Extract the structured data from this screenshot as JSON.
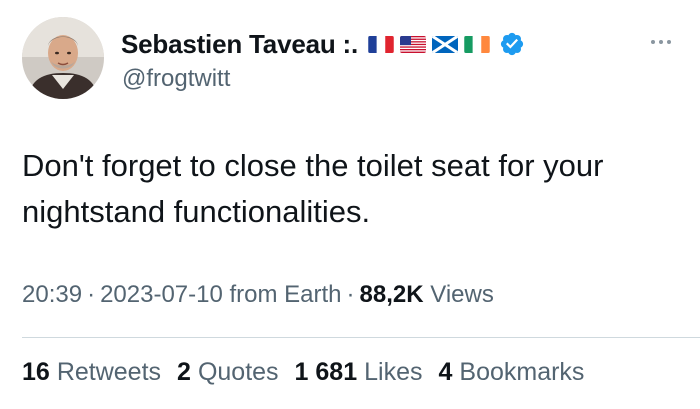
{
  "author": {
    "display_name": "Sebastien Taveau :.",
    "handle": "@frogtwitt",
    "flags": [
      "france-flag-icon",
      "usa-flag-icon",
      "scotland-flag-icon",
      "ireland-flag-icon"
    ],
    "verified": true
  },
  "tweet": {
    "text": "Don't forget to close the toilet seat for your nightstand functionalities.",
    "time": "20:39",
    "date": "2023-07-10",
    "source": "from Earth",
    "views_count": "88,2K",
    "views_label": "Views"
  },
  "stats": {
    "retweets_count": "16",
    "retweets_label": "Retweets",
    "quotes_count": "2",
    "quotes_label": "Quotes",
    "likes_count": "1 681",
    "likes_label": "Likes",
    "bookmarks_count": "4",
    "bookmarks_label": "Bookmarks"
  },
  "colors": {
    "text_primary": "#0f1419",
    "text_secondary": "#536471",
    "verified_blue": "#1d9bf0",
    "divider": "#cfd9de"
  }
}
